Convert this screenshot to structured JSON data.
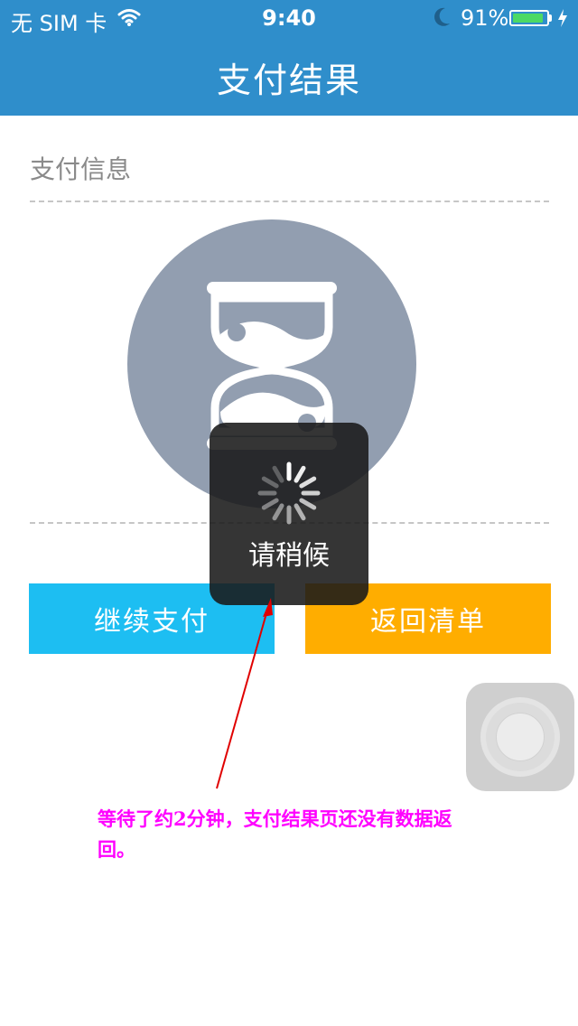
{
  "status_bar": {
    "carrier": "无 SIM 卡",
    "time": "9:40",
    "battery_percent": "91%",
    "battery_level": 0.91,
    "icons": [
      "wifi-icon",
      "moon-icon",
      "battery-icon",
      "charging-bolt-icon"
    ]
  },
  "nav": {
    "title": "支付结果"
  },
  "payment_info": {
    "section_label": "支付信息",
    "status_icon": "hourglass-icon"
  },
  "buttons": {
    "continue_label": "继续支付",
    "back_label": "返回清单"
  },
  "loading": {
    "text": "请稍候",
    "icon": "spinner-icon"
  },
  "annotation": {
    "text": "等待了约2分钟，支付结果页还没有数据返回。"
  },
  "colors": {
    "nav_bg": "#2f8ecb",
    "continue_bg": "#1dbef2",
    "back_bg": "#ffad00",
    "annotation": "#ff00ff",
    "arrow": "#e00000",
    "hourglass_bg": "#929eb0"
  }
}
